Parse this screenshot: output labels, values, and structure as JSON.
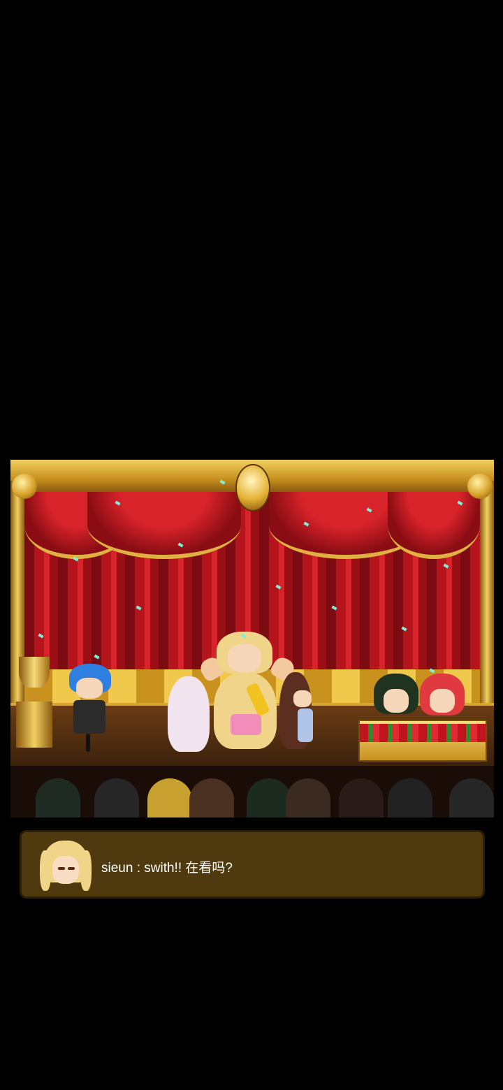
{
  "scene": {
    "name": "award-ceremony-stage",
    "colors": {
      "curtain": "#b5141c",
      "gold": "#e1b042",
      "confetti": "#7ef0d8"
    }
  },
  "dialog": {
    "speaker_icon": "blonde-girl-portrait",
    "message": "sieun : swith!! 在看吗?"
  }
}
